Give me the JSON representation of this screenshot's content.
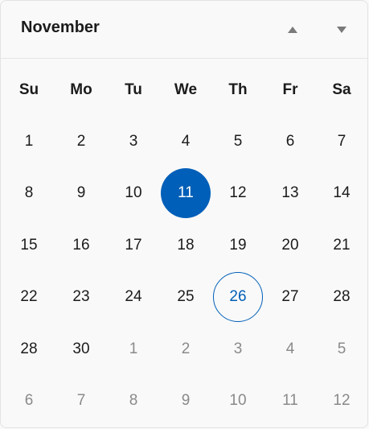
{
  "header": {
    "month": "November"
  },
  "weekdays": [
    "Su",
    "Mo",
    "Tu",
    "We",
    "Th",
    "Fr",
    "Sa"
  ],
  "weeks": [
    [
      {
        "d": "1"
      },
      {
        "d": "2"
      },
      {
        "d": "3"
      },
      {
        "d": "4"
      },
      {
        "d": "5"
      },
      {
        "d": "6"
      },
      {
        "d": "7"
      }
    ],
    [
      {
        "d": "8"
      },
      {
        "d": "9"
      },
      {
        "d": "10"
      },
      {
        "d": "11",
        "state": "selected"
      },
      {
        "d": "12"
      },
      {
        "d": "13"
      },
      {
        "d": "14"
      }
    ],
    [
      {
        "d": "15"
      },
      {
        "d": "16"
      },
      {
        "d": "17"
      },
      {
        "d": "18"
      },
      {
        "d": "19"
      },
      {
        "d": "20"
      },
      {
        "d": "21"
      }
    ],
    [
      {
        "d": "22"
      },
      {
        "d": "23"
      },
      {
        "d": "24"
      },
      {
        "d": "25"
      },
      {
        "d": "26",
        "state": "today"
      },
      {
        "d": "27"
      },
      {
        "d": "28"
      }
    ],
    [
      {
        "d": "28"
      },
      {
        "d": "30"
      },
      {
        "d": "1",
        "out": true
      },
      {
        "d": "2",
        "out": true
      },
      {
        "d": "3",
        "out": true
      },
      {
        "d": "4",
        "out": true
      },
      {
        "d": "5",
        "out": true
      }
    ],
    [
      {
        "d": "6",
        "out": true
      },
      {
        "d": "7",
        "out": true
      },
      {
        "d": "8",
        "out": true
      },
      {
        "d": "9",
        "out": true
      },
      {
        "d": "10",
        "out": true
      },
      {
        "d": "11",
        "out": true
      },
      {
        "d": "12",
        "out": true
      }
    ]
  ],
  "colors": {
    "accent": "#005fb8",
    "text": "#1b1b1b",
    "muted": "#8a8a8a",
    "background": "#f9f9f9"
  },
  "icons": {
    "previous": "triangle-up-icon",
    "next": "triangle-down-icon"
  }
}
